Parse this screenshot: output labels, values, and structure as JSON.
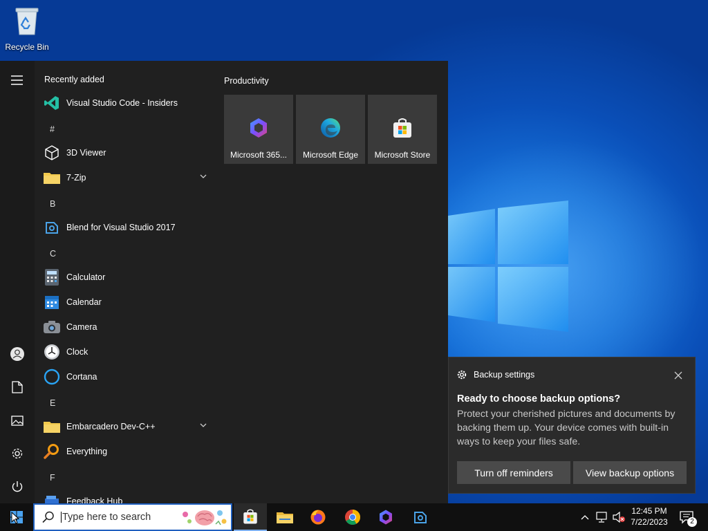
{
  "desktop": {
    "recycle_bin_label": "Recycle Bin"
  },
  "start_menu": {
    "list_header": "Recently added",
    "recent_apps": [
      {
        "label": "Visual Studio Code - Insiders",
        "icon": "vscode-insiders-icon"
      }
    ],
    "groups": [
      {
        "letter": "#"
      },
      {
        "letter": "B"
      },
      {
        "letter": "C"
      },
      {
        "letter": "E"
      },
      {
        "letter": "F"
      }
    ],
    "apps": [
      {
        "label": "3D Viewer",
        "icon": "cube-icon"
      },
      {
        "label": "7-Zip",
        "icon": "folder-icon",
        "expandable": true
      },
      {
        "label": "Blend for Visual Studio 2017",
        "icon": "blend-icon"
      },
      {
        "label": "Calculator",
        "icon": "calculator-icon"
      },
      {
        "label": "Calendar",
        "icon": "calendar-icon"
      },
      {
        "label": "Camera",
        "icon": "camera-icon"
      },
      {
        "label": "Clock",
        "icon": "clock-icon"
      },
      {
        "label": "Cortana",
        "icon": "cortana-icon"
      },
      {
        "label": "Embarcadero Dev-C++",
        "icon": "folder-icon",
        "expandable": true
      },
      {
        "label": "Everything",
        "icon": "magnifier-icon"
      },
      {
        "label": "Feedback Hub",
        "icon": "feedback-icon"
      }
    ],
    "tiles_header": "Productivity",
    "tiles": [
      {
        "label": "Microsoft 365...",
        "icon": "microsoft-365-icon"
      },
      {
        "label": "Microsoft Edge",
        "icon": "edge-icon"
      },
      {
        "label": "Microsoft Store",
        "icon": "store-icon"
      }
    ]
  },
  "toast": {
    "app_name": "Backup settings",
    "title": "Ready to choose backup options?",
    "body": "Protect your cherished pictures and documents by backing them up. Your device comes with built-in ways to keep your files safe.",
    "btn_reminders": "Turn off reminders",
    "btn_view": "View backup options"
  },
  "taskbar": {
    "search_placeholder": "Type here to search",
    "time": "12:45 PM",
    "date": "7/22/2023",
    "notification_count": "2"
  },
  "colors": {
    "accent": "#1f5fbf",
    "start_bg": "#202020",
    "tile_bg": "#3a3a3a"
  }
}
